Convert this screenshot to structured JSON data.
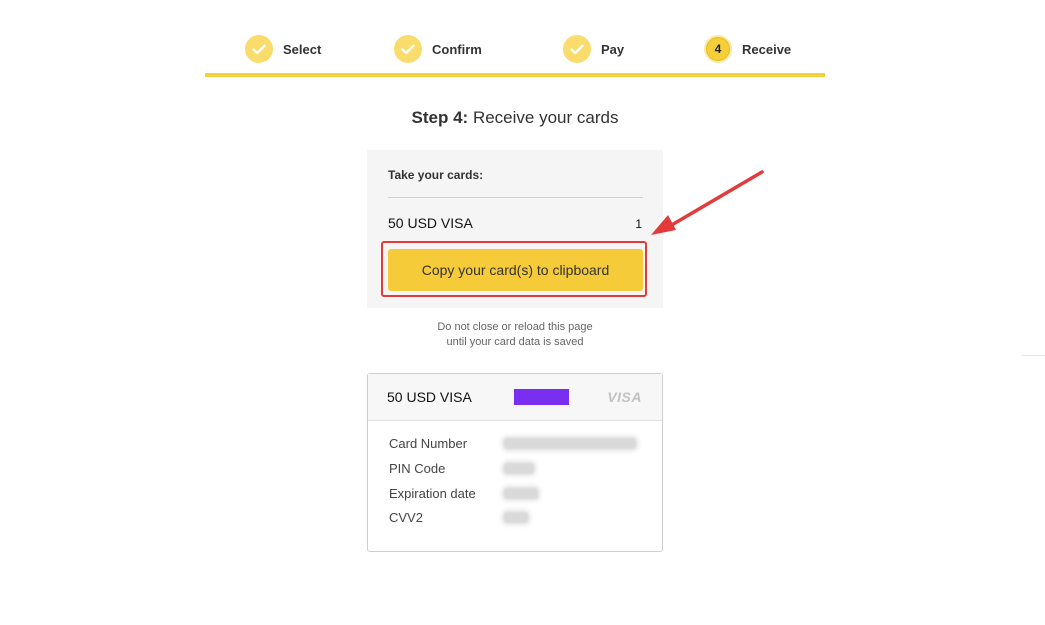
{
  "stepper": {
    "steps": [
      {
        "label": "Select",
        "status": "done"
      },
      {
        "label": "Confirm",
        "status": "done"
      },
      {
        "label": "Pay",
        "status": "done"
      },
      {
        "label": "Receive",
        "status": "current",
        "number": "4"
      }
    ],
    "accent_color": "#f5cf3a"
  },
  "title": {
    "prefix": "Step 4:",
    "text": "Receive your cards"
  },
  "take_cards": {
    "heading": "Take your cards:",
    "item_name": "50 USD VISA",
    "item_qty": "1",
    "copy_button_label": "Copy your card(s) to clipboard"
  },
  "warning": {
    "line1": "Do not close or reload this page",
    "line2": "until your card data is saved"
  },
  "card": {
    "name": "50 USD VISA",
    "brand": "VISA",
    "fields": [
      {
        "label": "Card Number"
      },
      {
        "label": "PIN Code"
      },
      {
        "label": "Expiration date"
      },
      {
        "label": "CVV2"
      }
    ]
  },
  "annotation_color": "#e33b3b"
}
